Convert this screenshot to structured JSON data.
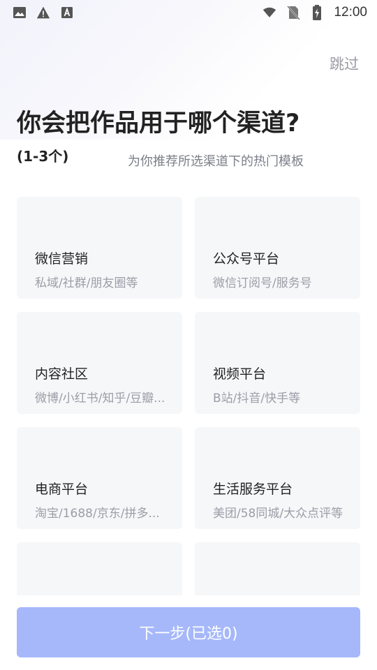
{
  "status_bar": {
    "time": "12:00",
    "icons_left": [
      "image-icon",
      "warning-icon",
      "a-box-icon"
    ],
    "icons_right": [
      "wifi-icon",
      "no-sim-icon",
      "battery-charging-icon"
    ]
  },
  "header": {
    "skip_label": "跳过",
    "title": "你会把作品用于哪个渠道?",
    "count_hint": "(1-3个)",
    "subtitle": "为你推荐所选渠道下的热门模板"
  },
  "channels": [
    {
      "title": "微信营销",
      "desc": "私域/社群/朋友圈等"
    },
    {
      "title": "公众号平台",
      "desc": "微信订阅号/服务号"
    },
    {
      "title": "内容社区",
      "desc": "微博/小红书/知乎/豆瓣..."
    },
    {
      "title": "视频平台",
      "desc": "B站/抖音/快手等"
    },
    {
      "title": "电商平台",
      "desc": "淘宝/1688/京东/拼多..."
    },
    {
      "title": "生活服务平台",
      "desc": "美团/58同城/大众点评等"
    },
    {
      "title": "",
      "desc": ""
    },
    {
      "title": "",
      "desc": ""
    }
  ],
  "footer": {
    "next_label": "下一步(已选0)"
  },
  "colors": {
    "accent_disabled": "#a6b8fa",
    "card_bg": "#f6f7f9",
    "muted_text": "#9a9ea6"
  }
}
